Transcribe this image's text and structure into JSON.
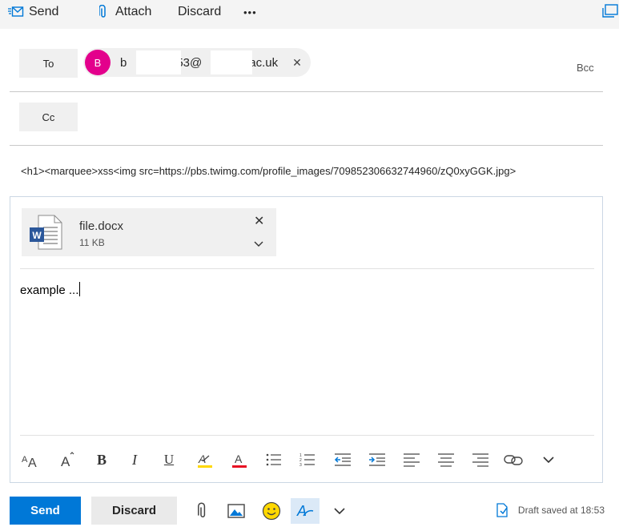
{
  "toolbar": {
    "send_label": "Send",
    "attach_label": "Attach",
    "discard_label": "Discard",
    "more_label": "•••"
  },
  "recipients": {
    "to_label": "To",
    "cc_label": "Cc",
    "bcc_label": "Bcc",
    "to_chip": {
      "initial": "B",
      "address_part1": "b",
      "address_part2": "53@",
      "address_part3": "ac.uk",
      "remove_glyph": "✕"
    }
  },
  "subject": {
    "value": "<h1><marquee>xss<img src=https://pbs.twimg.com/profile_images/709852306632744960/zQ0xyGGK.jpg>"
  },
  "attachment": {
    "file_name": "file.docx",
    "size": "11 KB",
    "file_type": "word",
    "remove_glyph": "✕",
    "expand_glyph": "⌄"
  },
  "body": {
    "text": "example ..."
  },
  "format_toolbar": {
    "icons": [
      "font-size-icon",
      "grow-font-icon",
      "bold-icon",
      "italic-icon",
      "underline-icon",
      "highlight-icon",
      "font-color-icon",
      "bullets-icon",
      "numbering-icon",
      "decrease-indent-icon",
      "increase-indent-icon",
      "align-left-icon",
      "align-center-icon",
      "align-right-icon",
      "link-icon",
      "more-formatting-icon"
    ],
    "bold_glyph": "B",
    "italic_glyph": "I",
    "underline_glyph": "U"
  },
  "actions": {
    "send_label": "Send",
    "discard_label": "Discard",
    "draft_status": "Draft saved at 18:53"
  },
  "colors": {
    "accent": "#0078d7",
    "avatar": "#e3008c",
    "word_blue": "#2b579a"
  }
}
